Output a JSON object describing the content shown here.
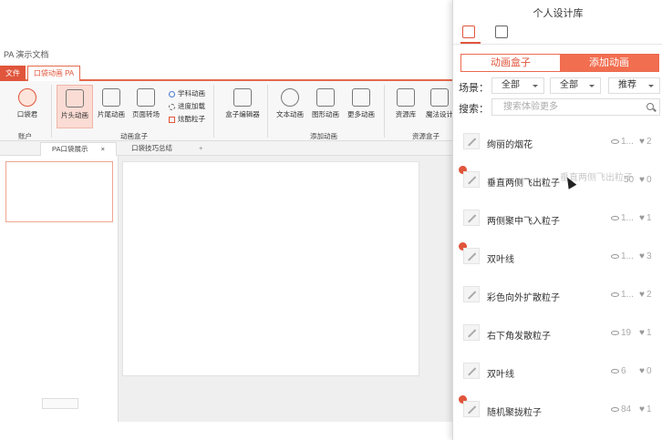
{
  "app": {
    "title": "PA 演示文档"
  },
  "menu": {
    "file": "文件",
    "tab": "口袋动画 PA"
  },
  "ribbon": {
    "account_btn": "口袋君",
    "account_group": "账户",
    "intro_anim": "片头动画",
    "outro_anim": "片尾动画",
    "page_transition": "页面转场",
    "small_items": [
      "学科动画",
      "进度加载",
      "炫酷粒子"
    ],
    "anim_box_group": "动画盒子",
    "box_editor": "盒子编辑器",
    "text_anim": "文本动画",
    "shape_anim": "图形动画",
    "more_anim": "更多动画",
    "add_anim_group": "添加动画",
    "resource_lib": "资源库",
    "magic_design": "魔法设计",
    "resource_group": "资源盒子"
  },
  "doc_tabs": [
    "PA口袋展示",
    "口袋技巧总结"
  ],
  "panel": {
    "title": "个人设计库",
    "seg_left": "动画盒子",
    "seg_right": "添加动画",
    "scene_label": "场景：",
    "filters": [
      "全部",
      "全部",
      "推荐"
    ],
    "search_label": "搜索：",
    "search_placeholder": "搜索体验更多",
    "drag_ghost": "垂直两侧飞出粒子"
  },
  "items": [
    {
      "name": "绚丽的烟花",
      "views": "1...",
      "likes": "2",
      "badge": false
    },
    {
      "name": "垂直两侧飞出粒子",
      "views": "50",
      "likes": "0",
      "badge": true
    },
    {
      "name": "两侧聚中飞入粒子",
      "views": "1...",
      "likes": "1",
      "badge": false
    },
    {
      "name": "双叶线",
      "views": "1...",
      "likes": "3",
      "badge": true
    },
    {
      "name": "彩色向外扩散粒子",
      "views": "1...",
      "likes": "2",
      "badge": false
    },
    {
      "name": "右下角发散粒子",
      "views": "19",
      "likes": "1",
      "badge": false
    },
    {
      "name": "双叶线",
      "views": "6",
      "likes": "0",
      "badge": false
    },
    {
      "name": "随机聚拢粒子",
      "views": "84",
      "likes": "1",
      "badge": true
    }
  ],
  "colors": {
    "accent": "#e0553b",
    "accent_light": "#f26e50"
  }
}
